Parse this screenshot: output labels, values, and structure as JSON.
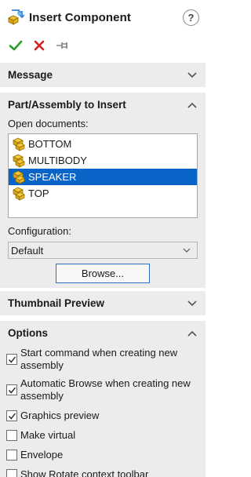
{
  "header": {
    "title": "Insert Component",
    "help_glyph": "?",
    "icon": "insert-component-icon"
  },
  "actions": {
    "ok": "check-icon",
    "cancel": "x-icon",
    "pin": "pushpin-icon",
    "ok_color": "#2a9d2a",
    "cancel_color": "#d42020"
  },
  "sections": {
    "message": {
      "label": "Message"
    },
    "part_assembly": {
      "label": "Part/Assembly to Insert",
      "open_documents_label": "Open documents:",
      "documents": [
        {
          "name": "BOTTOM",
          "selected": false
        },
        {
          "name": "MULTIBODY",
          "selected": false
        },
        {
          "name": "SPEAKER",
          "selected": true
        },
        {
          "name": "TOP",
          "selected": false
        }
      ],
      "configuration_label": "Configuration:",
      "configuration_value": "Default",
      "browse_label": "Browse..."
    },
    "thumbnail": {
      "label": "Thumbnail Preview"
    },
    "options": {
      "label": "Options",
      "items": [
        {
          "label": "Start command when creating new assembly",
          "checked": true
        },
        {
          "label": "Automatic Browse when creating new assembly",
          "checked": true
        },
        {
          "label": "Graphics preview",
          "checked": true
        },
        {
          "label": "Make virtual",
          "checked": false
        },
        {
          "label": "Envelope",
          "checked": false
        },
        {
          "label": "Show Rotate context toolbar",
          "checked": false
        }
      ]
    }
  },
  "colors": {
    "selection": "#0a64c8",
    "section_bg": "#ececec",
    "browse_border": "#2f6fc4"
  }
}
